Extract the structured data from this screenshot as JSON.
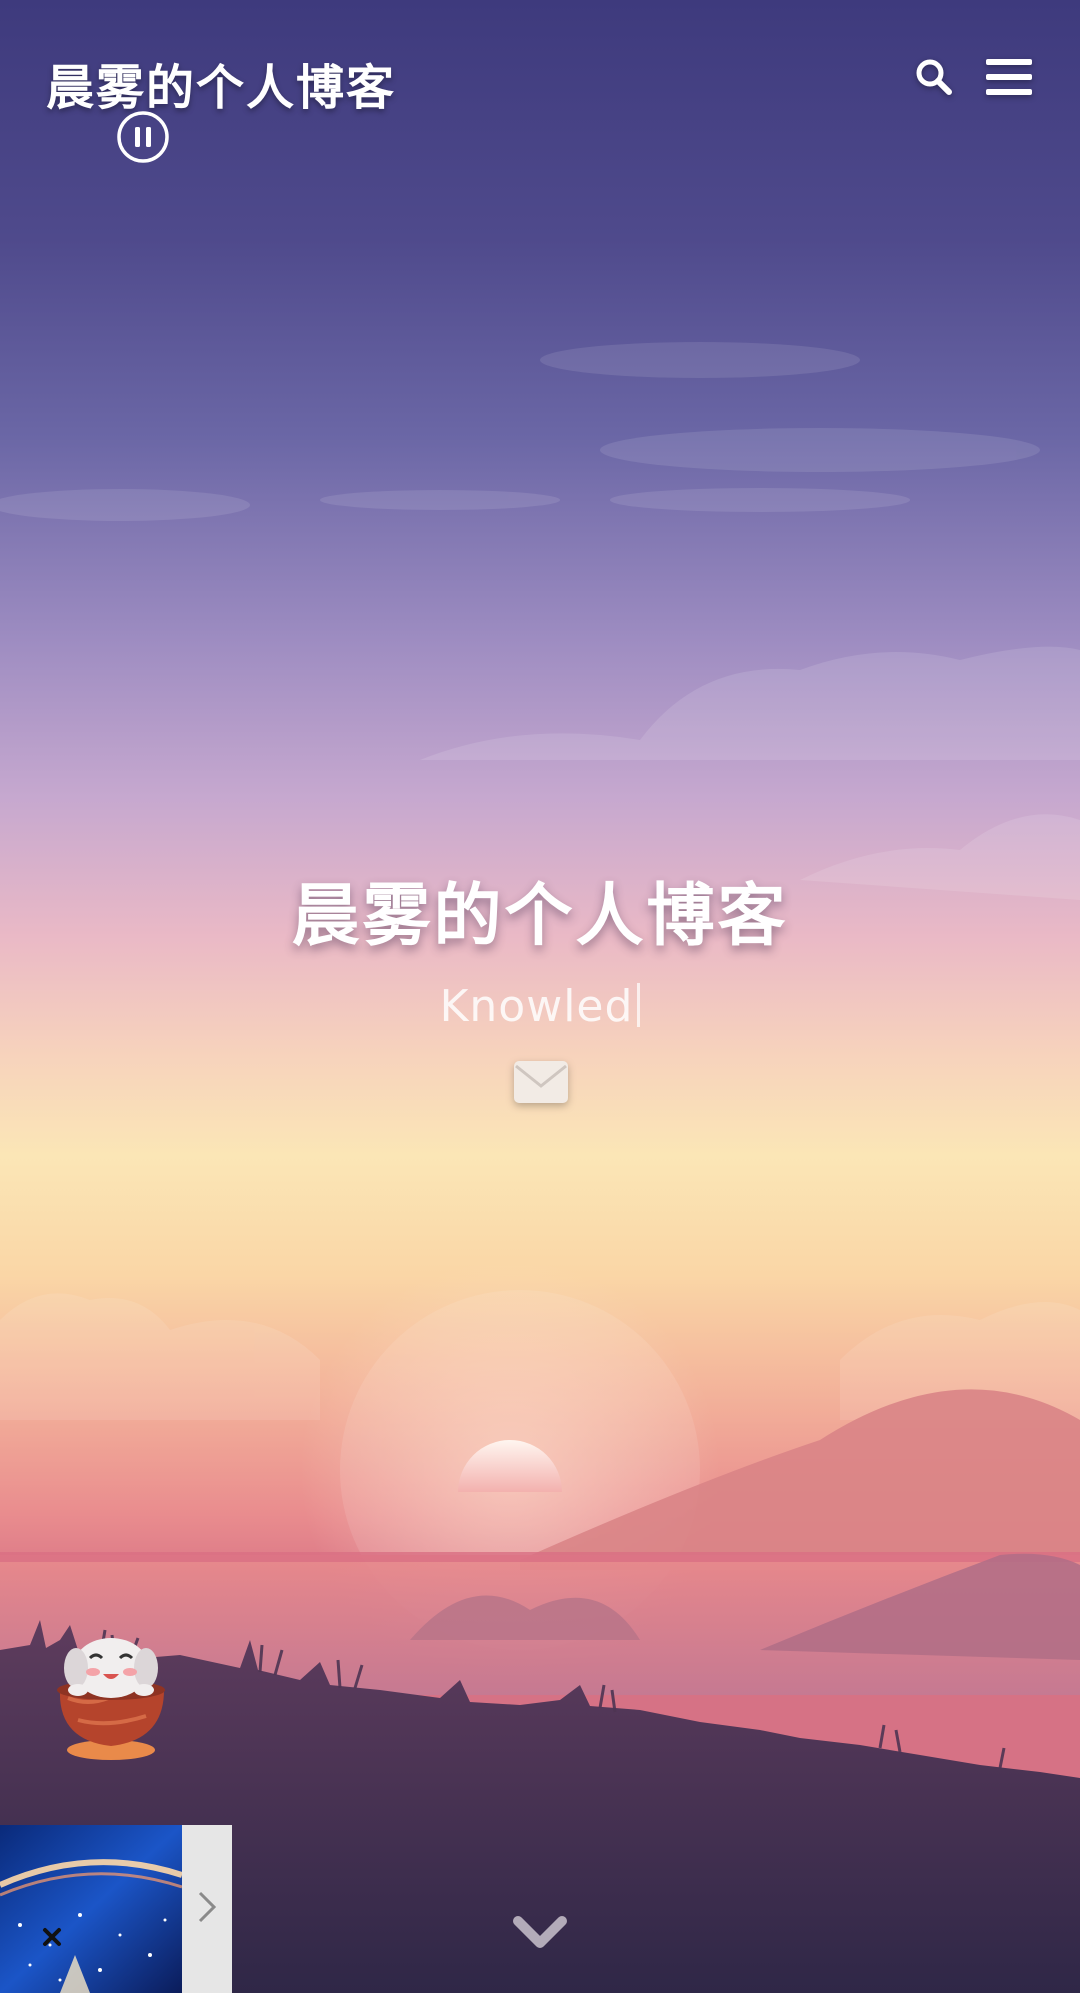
{
  "header": {
    "site_title": "晨雾的个人博客"
  },
  "hero": {
    "title": "晨雾的个人博客",
    "subtitle": "Knowled"
  },
  "icons": {
    "search": "search-icon",
    "menu": "menu-icon",
    "mail": "mail-icon",
    "scroll": "chevron-down-icon",
    "pause": "pause-icon",
    "close": "close-icon",
    "expand": "chevron-right-icon"
  },
  "colors": {
    "sky_top": "#3f3a7c",
    "sky_mid": "#b49ac9",
    "horizon_glow": "#fbe6b5",
    "sunset_pink": "#e98c8e",
    "ground_dark": "#3a2b4a",
    "text": "#ffffff"
  }
}
